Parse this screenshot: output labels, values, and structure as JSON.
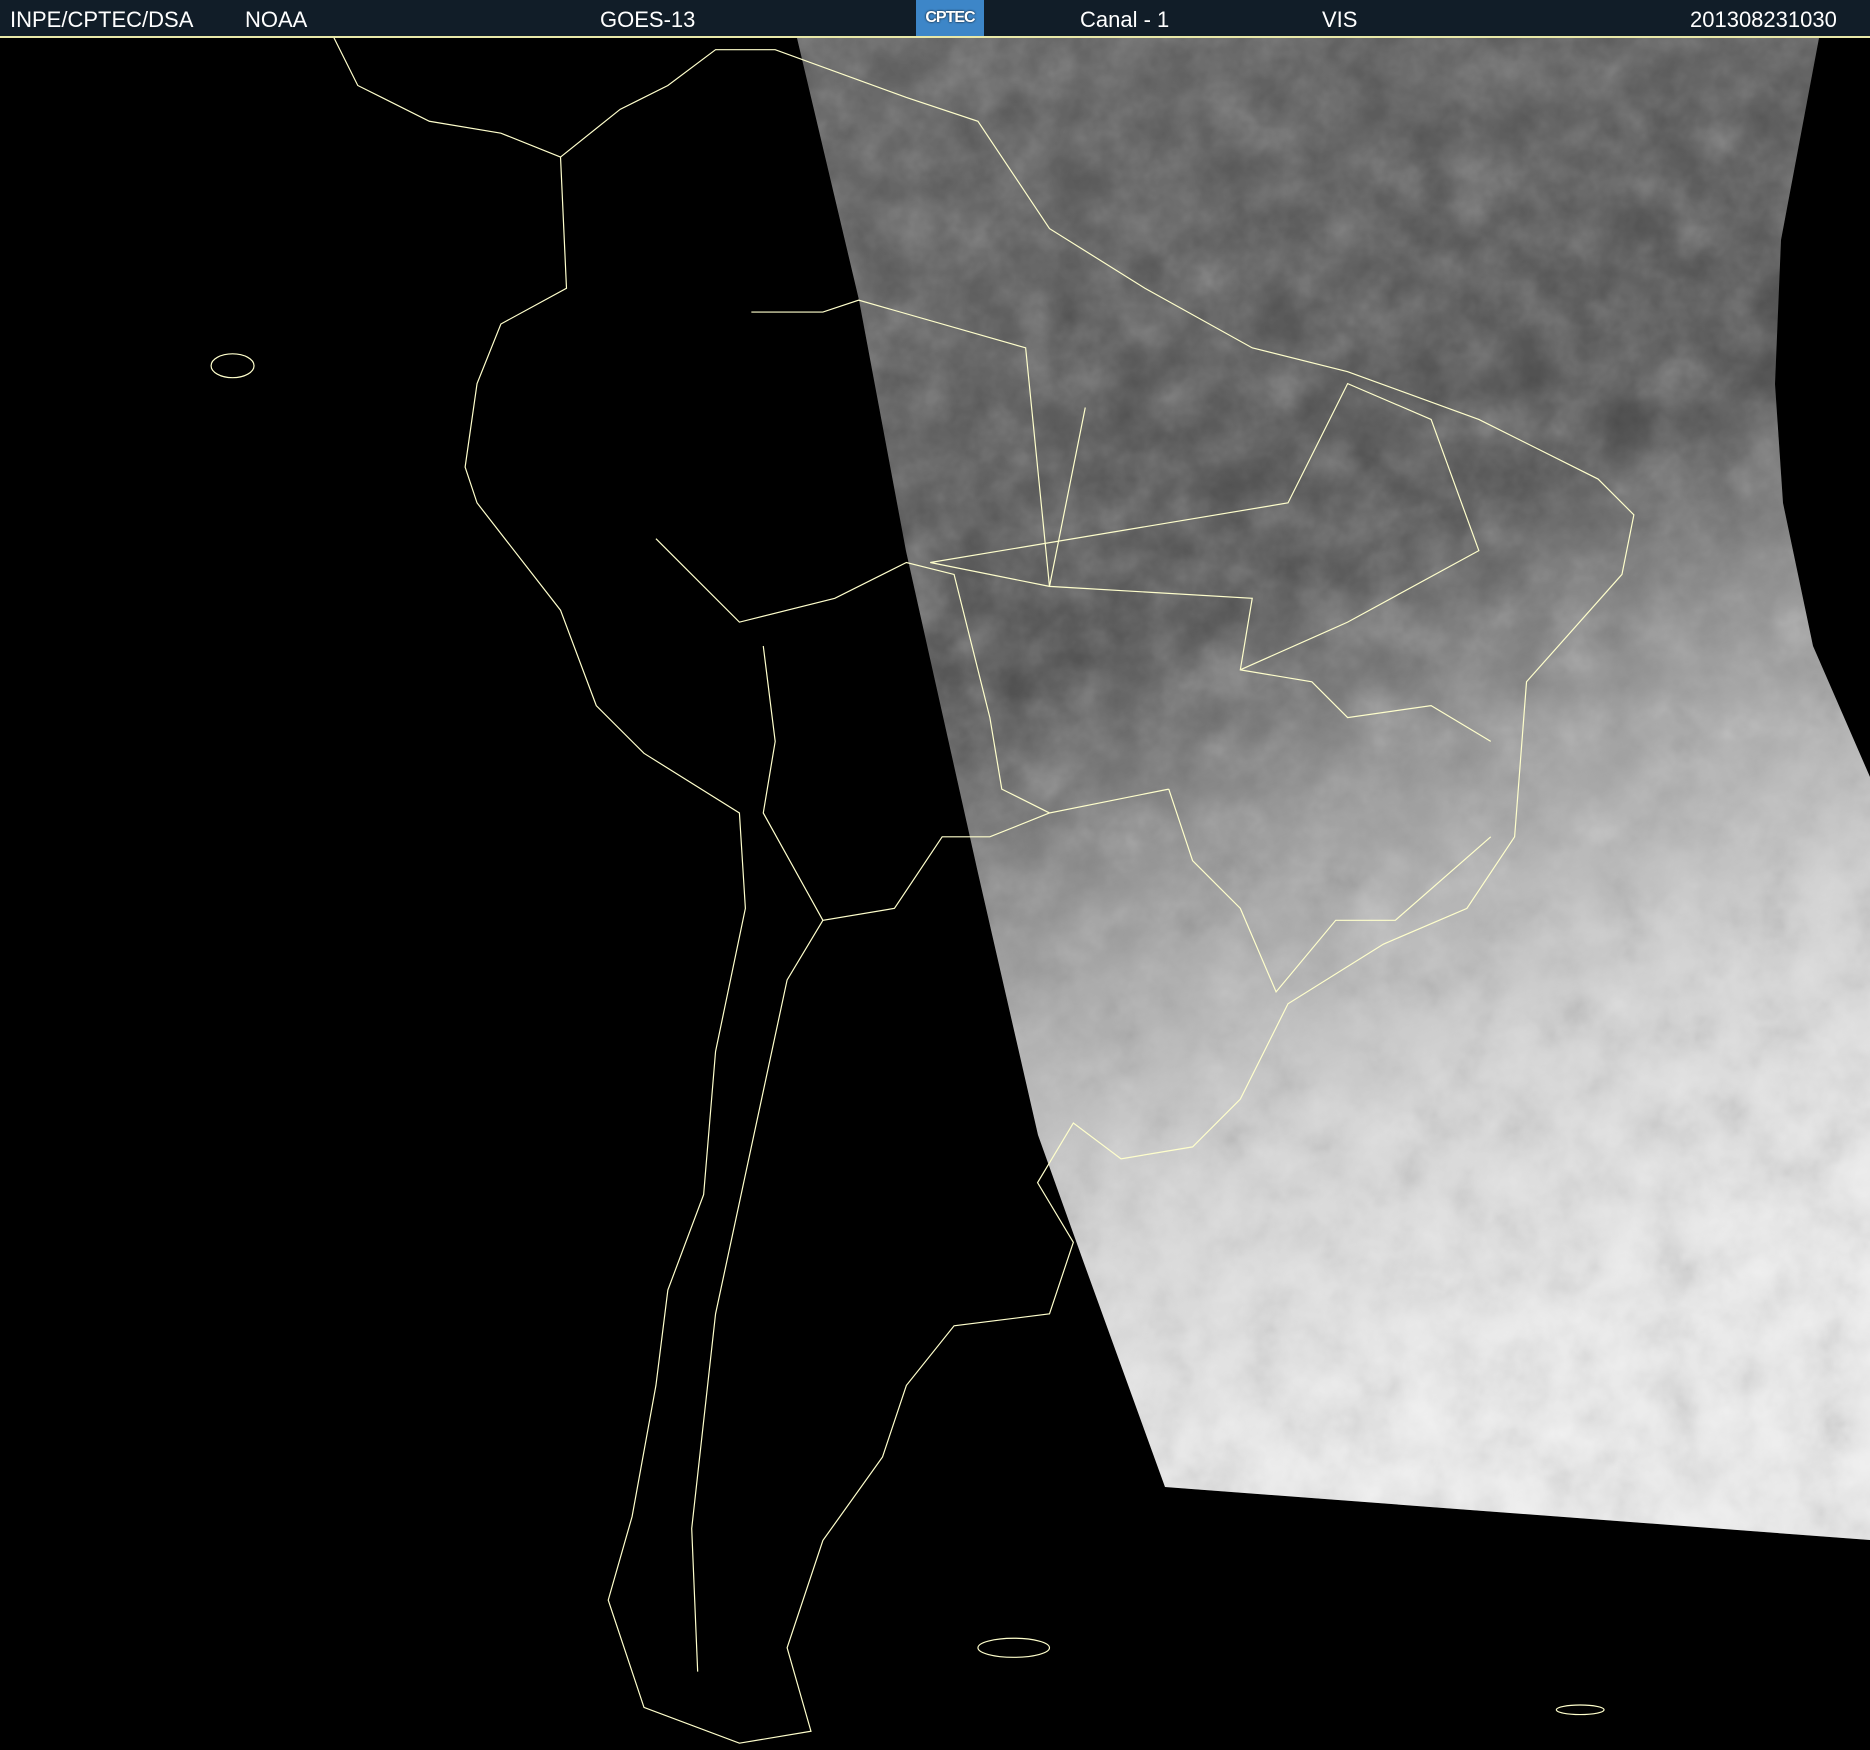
{
  "header": {
    "institution": "INPE/CPTEC/DSA",
    "agency": "NOAA",
    "satellite": "GOES-13",
    "logo_text": "CPTEC",
    "channel": "Canal - 1",
    "band": "VIS",
    "timestamp": "201308231030"
  },
  "colors": {
    "header_bg": "#111d28",
    "border_lines": "#ffffcc",
    "background": "#000000"
  }
}
